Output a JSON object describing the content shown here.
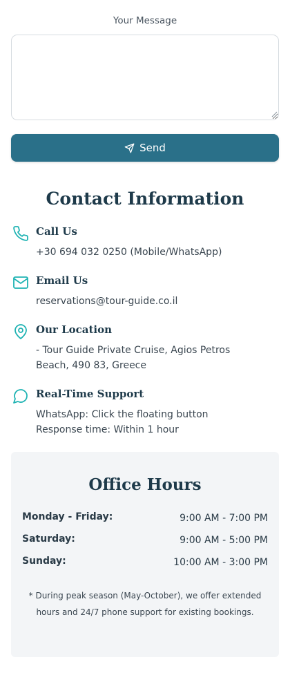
{
  "form": {
    "message_label": "Your Message",
    "message_value": "",
    "send_label": "Send"
  },
  "contact": {
    "title": "Contact Information",
    "items": [
      {
        "icon": "phone-icon",
        "title": "Call Us",
        "lines": [
          "+30 694 032 0250 (Mobile/WhatsApp)"
        ]
      },
      {
        "icon": "mail-icon",
        "title": "Email Us",
        "lines": [
          "reservations@tour-guide.co.il"
        ]
      },
      {
        "icon": "location-pin-icon",
        "title": "Our Location",
        "lines": [
          "- Tour Guide Private Cruise, Agios Petros",
          "Beach, 490 83, Greece"
        ]
      },
      {
        "icon": "chat-bubble-icon",
        "title": "Real-Time Support",
        "lines": [
          "WhatsApp: Click the floating button",
          "Response time: Within 1 hour"
        ]
      }
    ]
  },
  "office_hours": {
    "title": "Office Hours",
    "rows": [
      {
        "day": "Monday - Friday:",
        "time": "9:00 AM - 7:00 PM"
      },
      {
        "day": "Saturday:",
        "time": "9:00 AM - 5:00 PM"
      },
      {
        "day": "Sunday:",
        "time": "10:00 AM - 3:00 PM"
      }
    ],
    "note": "* During peak season (May-October), we offer extended hours and 24/7 phone support for existing bookings."
  },
  "colors": {
    "accent": "#2a7089",
    "icon": "#1fb3b3",
    "heading": "#1e3a4a",
    "panel": "#f3f5f7"
  }
}
